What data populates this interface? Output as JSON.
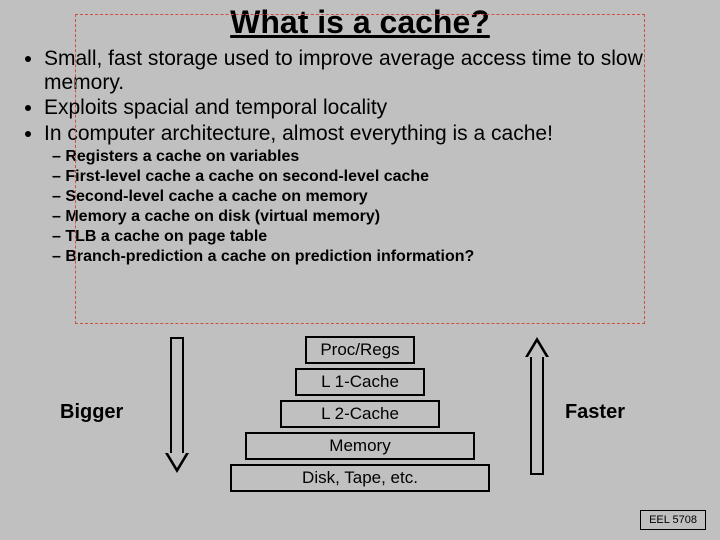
{
  "title": "What is a cache?",
  "bullets": [
    "Small, fast storage used to improve average access time to slow memory.",
    "Exploits spacial and temporal locality",
    "In computer architecture, almost everything is a cache!"
  ],
  "subbullets": [
    "Registers a cache on variables",
    "First-level cache a cache on second-level cache",
    "Second-level cache a cache on memory",
    "Memory a cache on disk (virtual memory)",
    "TLB a cache on page table",
    "Branch-prediction a cache on prediction information?"
  ],
  "levels": [
    "Proc/Regs",
    "L 1-Cache",
    "L 2-Cache",
    "Memory",
    "Disk, Tape, etc."
  ],
  "labels": {
    "bigger": "Bigger",
    "faster": "Faster"
  },
  "footer": "EEL 5708"
}
